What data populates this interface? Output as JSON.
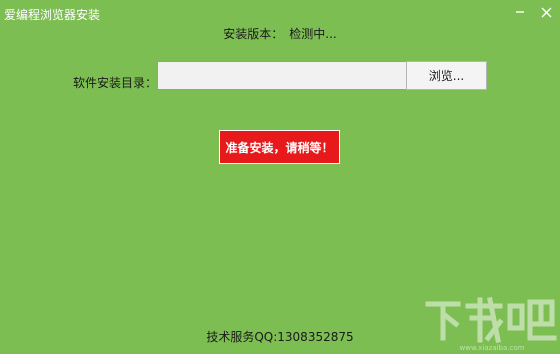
{
  "window": {
    "title": "爱编程浏览器安装",
    "background_color": "#7dbe52",
    "minimize_icon": "minimize-icon",
    "close_icon": "close-icon"
  },
  "version": {
    "label": "安装版本：",
    "status": "检测中..."
  },
  "install_dir": {
    "label": "软件安装目录：",
    "value": "",
    "browse_label": "浏览..."
  },
  "install_button": {
    "label": "准备安装，请稍等！",
    "color": "#e8191a"
  },
  "footer": {
    "service_text": "技术服务QQ:1308352875"
  },
  "watermark": {
    "text": "下载吧",
    "url_text": "www.xiazaiba.com"
  }
}
